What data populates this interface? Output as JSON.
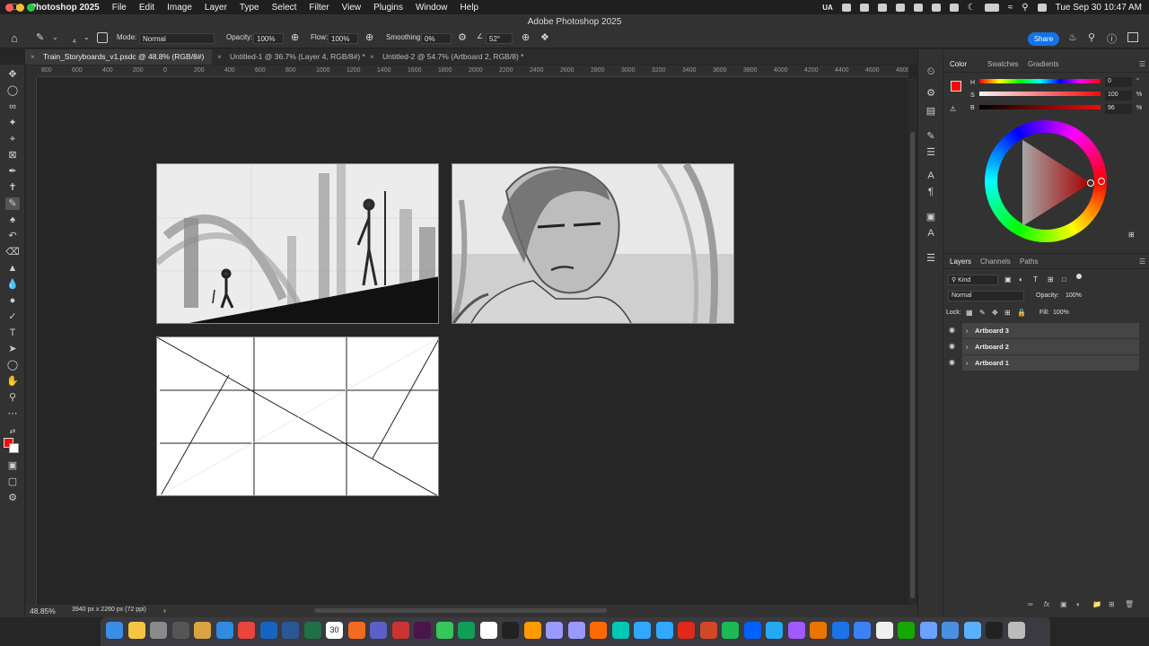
{
  "menubar": {
    "app_name": "Photoshop 2025",
    "items": [
      "File",
      "Edit",
      "Image",
      "Layer",
      "Type",
      "Select",
      "Filter",
      "View",
      "Plugins",
      "Window",
      "Help"
    ],
    "input_source": "UA",
    "datetime": "Tue Sep 30  10:47 AM"
  },
  "window": {
    "title": "Adobe Photoshop 2025"
  },
  "options_bar": {
    "brush_size": "4",
    "mode_label": "Mode:",
    "mode_value": "Normal",
    "opacity_label": "Opacity:",
    "opacity_value": "100%",
    "flow_label": "Flow:",
    "flow_value": "100%",
    "smoothing_label": "Smoothing:",
    "smoothing_value": "0%",
    "angle_value": "52°",
    "share_label": "Share"
  },
  "tabs": [
    {
      "label": "Train_Storyboards_v1.psdc @ 48.8% (RGB/8#)",
      "active": true
    },
    {
      "label": "Untitled-1 @ 36.7% (Layer 4, RGB/8#) *",
      "active": false
    },
    {
      "label": "Untitled-2 @ 54.7% (Artboard 2, RGB/8) *",
      "active": false
    }
  ],
  "ruler": {
    "h_labels": [
      "800",
      "600",
      "400",
      "200",
      "0",
      "200",
      "400",
      "600",
      "800",
      "1000",
      "1200",
      "1400",
      "1600",
      "1800",
      "2000",
      "2200",
      "2400",
      "2600",
      "2800",
      "3000",
      "3200",
      "3400",
      "3600",
      "3800",
      "4000",
      "4200",
      "4400",
      "4600",
      "4800",
      "5000"
    ]
  },
  "status": {
    "zoom": "48.85%",
    "doc_size": "3940 px x 2260 px (72 ppi)"
  },
  "color_panel": {
    "tabs": [
      "Color",
      "Swatches",
      "Gradients"
    ],
    "h_label": "H",
    "h_value": "0",
    "h_unit": "°",
    "s_label": "S",
    "s_value": "100",
    "s_unit": "%",
    "b_label": "B",
    "b_value": "96",
    "b_unit": "%",
    "foreground": "#f50a0a"
  },
  "layers_panel": {
    "tabs": [
      "Layers",
      "Channels",
      "Paths"
    ],
    "filter_kind": "Kind",
    "blend_mode": "Normal",
    "opacity_label": "Opacity:",
    "opacity_value": "100%",
    "lock_label": "Lock:",
    "fill_label": "Fill:",
    "fill_value": "100%",
    "layers": [
      "Artboard 3",
      "Artboard 2",
      "Artboard 1"
    ]
  },
  "dock": {
    "apps": [
      "Finder",
      "Notes",
      "Settings",
      "Calculator",
      "Pencil",
      "Safari",
      "Chrome",
      "Outlook",
      "Word",
      "Excel",
      "Calendar",
      "Harvest",
      "Teams",
      "Scrivener",
      "Slack",
      "Messages",
      "Sheets",
      "Notion",
      "Live",
      "Illustrator",
      "Premiere",
      "After Effects",
      "Animate",
      "Audition",
      "Photoshop",
      "Lightroom Classic",
      "Acrobat",
      "PowerPoint",
      "Spotify",
      "Dropbox",
      "VS Code",
      "Figma",
      "Blender",
      "Writer",
      "Web",
      "Pen",
      "Upwork",
      "Preview",
      "Folder",
      "Downloads",
      "Terminal",
      "Trash"
    ],
    "calendar_day": "30"
  },
  "colors": {
    "accent": "#1473e6",
    "panel": "#323232",
    "canvas": "#262626"
  }
}
